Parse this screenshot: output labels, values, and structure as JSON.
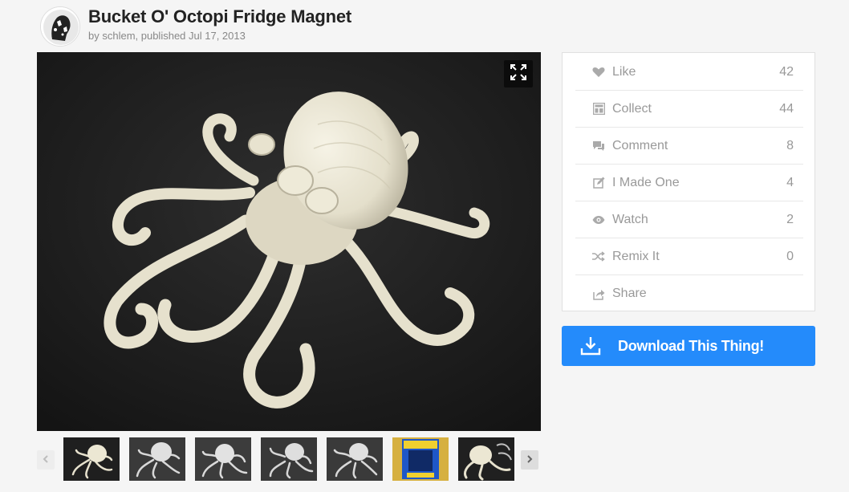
{
  "thing": {
    "title": "Bucket O' Octopi Fridge Magnet",
    "byline": "by schlem, published Jul 17, 2013"
  },
  "gallery": {
    "fullscreen_icon": "expand-icon",
    "prev_icon": "chevron-left-icon",
    "next_icon": "chevron-right-icon",
    "thumbnail_count": 7
  },
  "stats": [
    {
      "label": "Like",
      "count": "42",
      "icon": "heart-icon"
    },
    {
      "label": "Collect",
      "count": "44",
      "icon": "collection-icon"
    },
    {
      "label": "Comment",
      "count": "8",
      "icon": "comment-icon"
    },
    {
      "label": "I Made One",
      "count": "4",
      "icon": "edit-icon"
    },
    {
      "label": "Watch",
      "count": "2",
      "icon": "eye-icon"
    },
    {
      "label": "Remix It",
      "count": "0",
      "icon": "shuffle-icon"
    },
    {
      "label": "Share",
      "count": "",
      "icon": "share-icon"
    }
  ],
  "download": {
    "label": "Download This Thing!",
    "icon": "download-icon"
  },
  "colors": {
    "accent": "#248bfb",
    "muted_text": "#999999",
    "background": "#f5f5f5"
  }
}
